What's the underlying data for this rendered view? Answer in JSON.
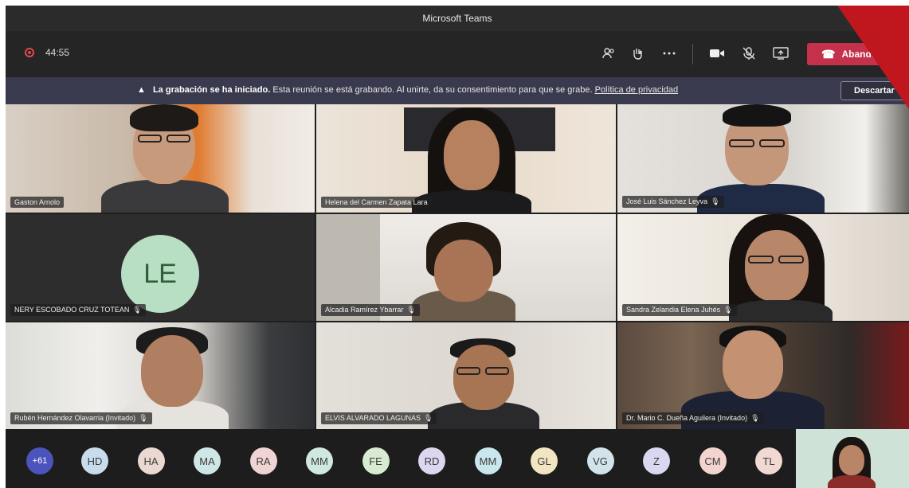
{
  "window": {
    "title": "Microsoft Teams"
  },
  "meeting": {
    "timer": "44:55"
  },
  "controls": {
    "participants_icon": "people-icon",
    "raise_hand_icon": "raise-hand-icon",
    "more_icon": "more-icon",
    "camera_icon": "camera-icon",
    "mic_icon": "mic-off-icon",
    "share_icon": "share-screen-icon",
    "leave_label": "Abandonar",
    "leave_color": "#c4314b"
  },
  "banner": {
    "bold_text": "La grabación se ha iniciado.",
    "text": "Esta reunión se está grabando. Al unirte, da su consentimiento para que se grabe.",
    "link": "Política de privacidad",
    "dismiss_label": "Descartar"
  },
  "tiles": [
    {
      "name": "Gaston Arnolo"
    },
    {
      "name": "Helena del Carmen Zapata Lara"
    },
    {
      "name": "José Luis Sánchez Leyva"
    },
    {
      "name": "NERY ESCOBADO CRUZ TOTEAN",
      "initials": "LE"
    },
    {
      "name": "Alcadia Ramírez Ybarrar"
    },
    {
      "name": "Sandra Zelandia Elena Juhés"
    },
    {
      "name": "Rubén Hernández Olavarria (Invitado)"
    },
    {
      "name": "ELVIS ALVARADO LAGUNAS"
    },
    {
      "name": "Dr. Mario C. Dueña Aguilera (Invitado)"
    }
  ],
  "participants_strip": {
    "overflow": "+61",
    "chips": [
      {
        "initials": "HD",
        "color": "#c9dcec"
      },
      {
        "initials": "HA",
        "color": "#ead8d2"
      },
      {
        "initials": "MA",
        "color": "#cfe6e6"
      },
      {
        "initials": "RA",
        "color": "#f0d3d3"
      },
      {
        "initials": "MM",
        "color": "#cfe9e0"
      },
      {
        "initials": "FE",
        "color": "#d8ead2"
      },
      {
        "initials": "RD",
        "color": "#ddd6ef"
      },
      {
        "initials": "MM",
        "color": "#c9e6ec"
      },
      {
        "initials": "GL",
        "color": "#f2e6c2"
      },
      {
        "initials": "VG",
        "color": "#d2e4ea"
      },
      {
        "initials": "Z",
        "color": "#d8d8f0"
      },
      {
        "initials": "CM",
        "color": "#f3d4cf"
      },
      {
        "initials": "TL",
        "color": "#f2d8d2"
      }
    ]
  }
}
